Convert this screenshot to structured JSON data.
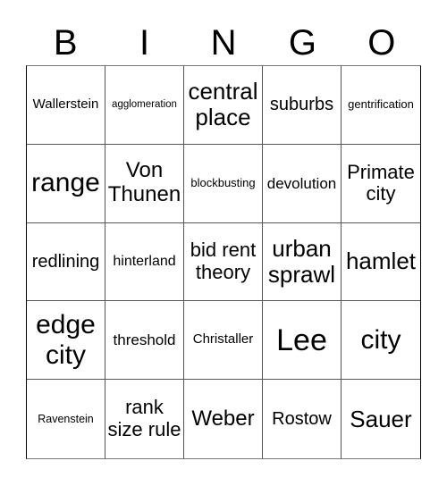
{
  "header": {
    "letters": [
      "B",
      "I",
      "N",
      "G",
      "O"
    ]
  },
  "board": {
    "rows": [
      [
        "Wallerstein",
        "agglomeration",
        "central place",
        "suburbs",
        "gentrification"
      ],
      [
        "range",
        "Von Thunen",
        "blockbusting",
        "devolution",
        "Primate city"
      ],
      [
        "redlining",
        "hinterland",
        "bid rent theory",
        "urban sprawl",
        "hamlet"
      ],
      [
        "edge city",
        "threshold",
        "Christaller",
        "Lee",
        "city"
      ],
      [
        "Ravenstein",
        "rank size rule",
        "Weber",
        "Rostow",
        "Sauer"
      ]
    ]
  }
}
